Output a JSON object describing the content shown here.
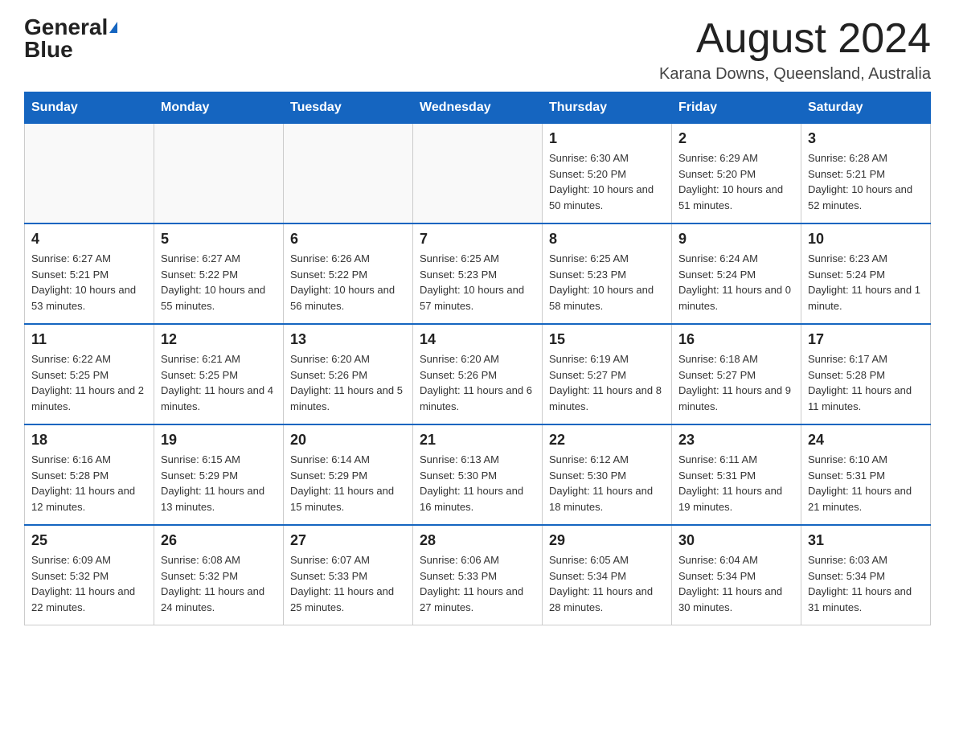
{
  "logo": {
    "general": "General",
    "blue": "Blue"
  },
  "title": "August 2024",
  "subtitle": "Karana Downs, Queensland, Australia",
  "days_of_week": [
    "Sunday",
    "Monday",
    "Tuesday",
    "Wednesday",
    "Thursday",
    "Friday",
    "Saturday"
  ],
  "weeks": [
    [
      {
        "day": "",
        "sunrise": "",
        "sunset": "",
        "daylight": ""
      },
      {
        "day": "",
        "sunrise": "",
        "sunset": "",
        "daylight": ""
      },
      {
        "day": "",
        "sunrise": "",
        "sunset": "",
        "daylight": ""
      },
      {
        "day": "",
        "sunrise": "",
        "sunset": "",
        "daylight": ""
      },
      {
        "day": "1",
        "sunrise": "Sunrise: 6:30 AM",
        "sunset": "Sunset: 5:20 PM",
        "daylight": "Daylight: 10 hours and 50 minutes."
      },
      {
        "day": "2",
        "sunrise": "Sunrise: 6:29 AM",
        "sunset": "Sunset: 5:20 PM",
        "daylight": "Daylight: 10 hours and 51 minutes."
      },
      {
        "day": "3",
        "sunrise": "Sunrise: 6:28 AM",
        "sunset": "Sunset: 5:21 PM",
        "daylight": "Daylight: 10 hours and 52 minutes."
      }
    ],
    [
      {
        "day": "4",
        "sunrise": "Sunrise: 6:27 AM",
        "sunset": "Sunset: 5:21 PM",
        "daylight": "Daylight: 10 hours and 53 minutes."
      },
      {
        "day": "5",
        "sunrise": "Sunrise: 6:27 AM",
        "sunset": "Sunset: 5:22 PM",
        "daylight": "Daylight: 10 hours and 55 minutes."
      },
      {
        "day": "6",
        "sunrise": "Sunrise: 6:26 AM",
        "sunset": "Sunset: 5:22 PM",
        "daylight": "Daylight: 10 hours and 56 minutes."
      },
      {
        "day": "7",
        "sunrise": "Sunrise: 6:25 AM",
        "sunset": "Sunset: 5:23 PM",
        "daylight": "Daylight: 10 hours and 57 minutes."
      },
      {
        "day": "8",
        "sunrise": "Sunrise: 6:25 AM",
        "sunset": "Sunset: 5:23 PM",
        "daylight": "Daylight: 10 hours and 58 minutes."
      },
      {
        "day": "9",
        "sunrise": "Sunrise: 6:24 AM",
        "sunset": "Sunset: 5:24 PM",
        "daylight": "Daylight: 11 hours and 0 minutes."
      },
      {
        "day": "10",
        "sunrise": "Sunrise: 6:23 AM",
        "sunset": "Sunset: 5:24 PM",
        "daylight": "Daylight: 11 hours and 1 minute."
      }
    ],
    [
      {
        "day": "11",
        "sunrise": "Sunrise: 6:22 AM",
        "sunset": "Sunset: 5:25 PM",
        "daylight": "Daylight: 11 hours and 2 minutes."
      },
      {
        "day": "12",
        "sunrise": "Sunrise: 6:21 AM",
        "sunset": "Sunset: 5:25 PM",
        "daylight": "Daylight: 11 hours and 4 minutes."
      },
      {
        "day": "13",
        "sunrise": "Sunrise: 6:20 AM",
        "sunset": "Sunset: 5:26 PM",
        "daylight": "Daylight: 11 hours and 5 minutes."
      },
      {
        "day": "14",
        "sunrise": "Sunrise: 6:20 AM",
        "sunset": "Sunset: 5:26 PM",
        "daylight": "Daylight: 11 hours and 6 minutes."
      },
      {
        "day": "15",
        "sunrise": "Sunrise: 6:19 AM",
        "sunset": "Sunset: 5:27 PM",
        "daylight": "Daylight: 11 hours and 8 minutes."
      },
      {
        "day": "16",
        "sunrise": "Sunrise: 6:18 AM",
        "sunset": "Sunset: 5:27 PM",
        "daylight": "Daylight: 11 hours and 9 minutes."
      },
      {
        "day": "17",
        "sunrise": "Sunrise: 6:17 AM",
        "sunset": "Sunset: 5:28 PM",
        "daylight": "Daylight: 11 hours and 11 minutes."
      }
    ],
    [
      {
        "day": "18",
        "sunrise": "Sunrise: 6:16 AM",
        "sunset": "Sunset: 5:28 PM",
        "daylight": "Daylight: 11 hours and 12 minutes."
      },
      {
        "day": "19",
        "sunrise": "Sunrise: 6:15 AM",
        "sunset": "Sunset: 5:29 PM",
        "daylight": "Daylight: 11 hours and 13 minutes."
      },
      {
        "day": "20",
        "sunrise": "Sunrise: 6:14 AM",
        "sunset": "Sunset: 5:29 PM",
        "daylight": "Daylight: 11 hours and 15 minutes."
      },
      {
        "day": "21",
        "sunrise": "Sunrise: 6:13 AM",
        "sunset": "Sunset: 5:30 PM",
        "daylight": "Daylight: 11 hours and 16 minutes."
      },
      {
        "day": "22",
        "sunrise": "Sunrise: 6:12 AM",
        "sunset": "Sunset: 5:30 PM",
        "daylight": "Daylight: 11 hours and 18 minutes."
      },
      {
        "day": "23",
        "sunrise": "Sunrise: 6:11 AM",
        "sunset": "Sunset: 5:31 PM",
        "daylight": "Daylight: 11 hours and 19 minutes."
      },
      {
        "day": "24",
        "sunrise": "Sunrise: 6:10 AM",
        "sunset": "Sunset: 5:31 PM",
        "daylight": "Daylight: 11 hours and 21 minutes."
      }
    ],
    [
      {
        "day": "25",
        "sunrise": "Sunrise: 6:09 AM",
        "sunset": "Sunset: 5:32 PM",
        "daylight": "Daylight: 11 hours and 22 minutes."
      },
      {
        "day": "26",
        "sunrise": "Sunrise: 6:08 AM",
        "sunset": "Sunset: 5:32 PM",
        "daylight": "Daylight: 11 hours and 24 minutes."
      },
      {
        "day": "27",
        "sunrise": "Sunrise: 6:07 AM",
        "sunset": "Sunset: 5:33 PM",
        "daylight": "Daylight: 11 hours and 25 minutes."
      },
      {
        "day": "28",
        "sunrise": "Sunrise: 6:06 AM",
        "sunset": "Sunset: 5:33 PM",
        "daylight": "Daylight: 11 hours and 27 minutes."
      },
      {
        "day": "29",
        "sunrise": "Sunrise: 6:05 AM",
        "sunset": "Sunset: 5:34 PM",
        "daylight": "Daylight: 11 hours and 28 minutes."
      },
      {
        "day": "30",
        "sunrise": "Sunrise: 6:04 AM",
        "sunset": "Sunset: 5:34 PM",
        "daylight": "Daylight: 11 hours and 30 minutes."
      },
      {
        "day": "31",
        "sunrise": "Sunrise: 6:03 AM",
        "sunset": "Sunset: 5:34 PM",
        "daylight": "Daylight: 11 hours and 31 minutes."
      }
    ]
  ]
}
